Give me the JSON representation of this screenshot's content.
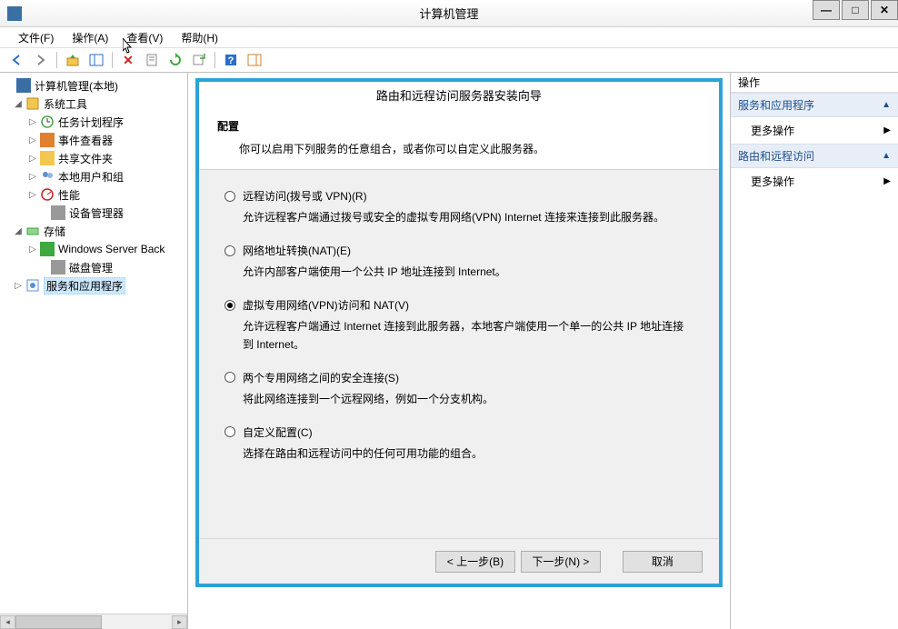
{
  "window": {
    "title": "计算机管理",
    "min": "—",
    "max": "□",
    "close": "✕"
  },
  "menu": {
    "file": "文件(F)",
    "action": "操作(A)",
    "view": "查看(V)",
    "help": "帮助(H)"
  },
  "tree": {
    "root": "计算机管理(本地)",
    "system_tools": "系统工具",
    "task_scheduler": "任务计划程序",
    "event_viewer": "事件查看器",
    "shared_folders": "共享文件夹",
    "local_users": "本地用户和组",
    "performance": "性能",
    "device_manager": "设备管理器",
    "storage": "存储",
    "wsb": "Windows Server Back",
    "disk_mgmt": "磁盘管理",
    "services_apps": "服务和应用程序"
  },
  "wizard": {
    "title": "路由和远程访问服务器安装向导",
    "heading": "配置",
    "subheading": "你可以启用下列服务的任意组合，或者你可以自定义此服务器。",
    "options": [
      {
        "label": "远程访问(拨号或 VPN)(R)",
        "desc": "允许远程客户端通过拨号或安全的虚拟专用网络(VPN) Internet 连接来连接到此服务器。",
        "checked": false
      },
      {
        "label": "网络地址转换(NAT)(E)",
        "desc": "允许内部客户端使用一个公共 IP 地址连接到 Internet。",
        "checked": false
      },
      {
        "label": "虚拟专用网络(VPN)访问和 NAT(V)",
        "desc": "允许远程客户端通过 Internet 连接到此服务器，本地客户端使用一个单一的公共 IP 地址连接到 Internet。",
        "checked": true
      },
      {
        "label": "两个专用网络之间的安全连接(S)",
        "desc": "将此网络连接到一个远程网络，例如一个分支机构。",
        "checked": false
      },
      {
        "label": "自定义配置(C)",
        "desc": "选择在路由和远程访问中的任何可用功能的组合。",
        "checked": false
      }
    ],
    "back": "< 上一步(B)",
    "next": "下一步(N) >",
    "cancel": "取消"
  },
  "actions": {
    "header": "操作",
    "section1": "服务和应用程序",
    "more1": "更多操作",
    "section2": "路由和远程访问",
    "more2": "更多操作"
  }
}
